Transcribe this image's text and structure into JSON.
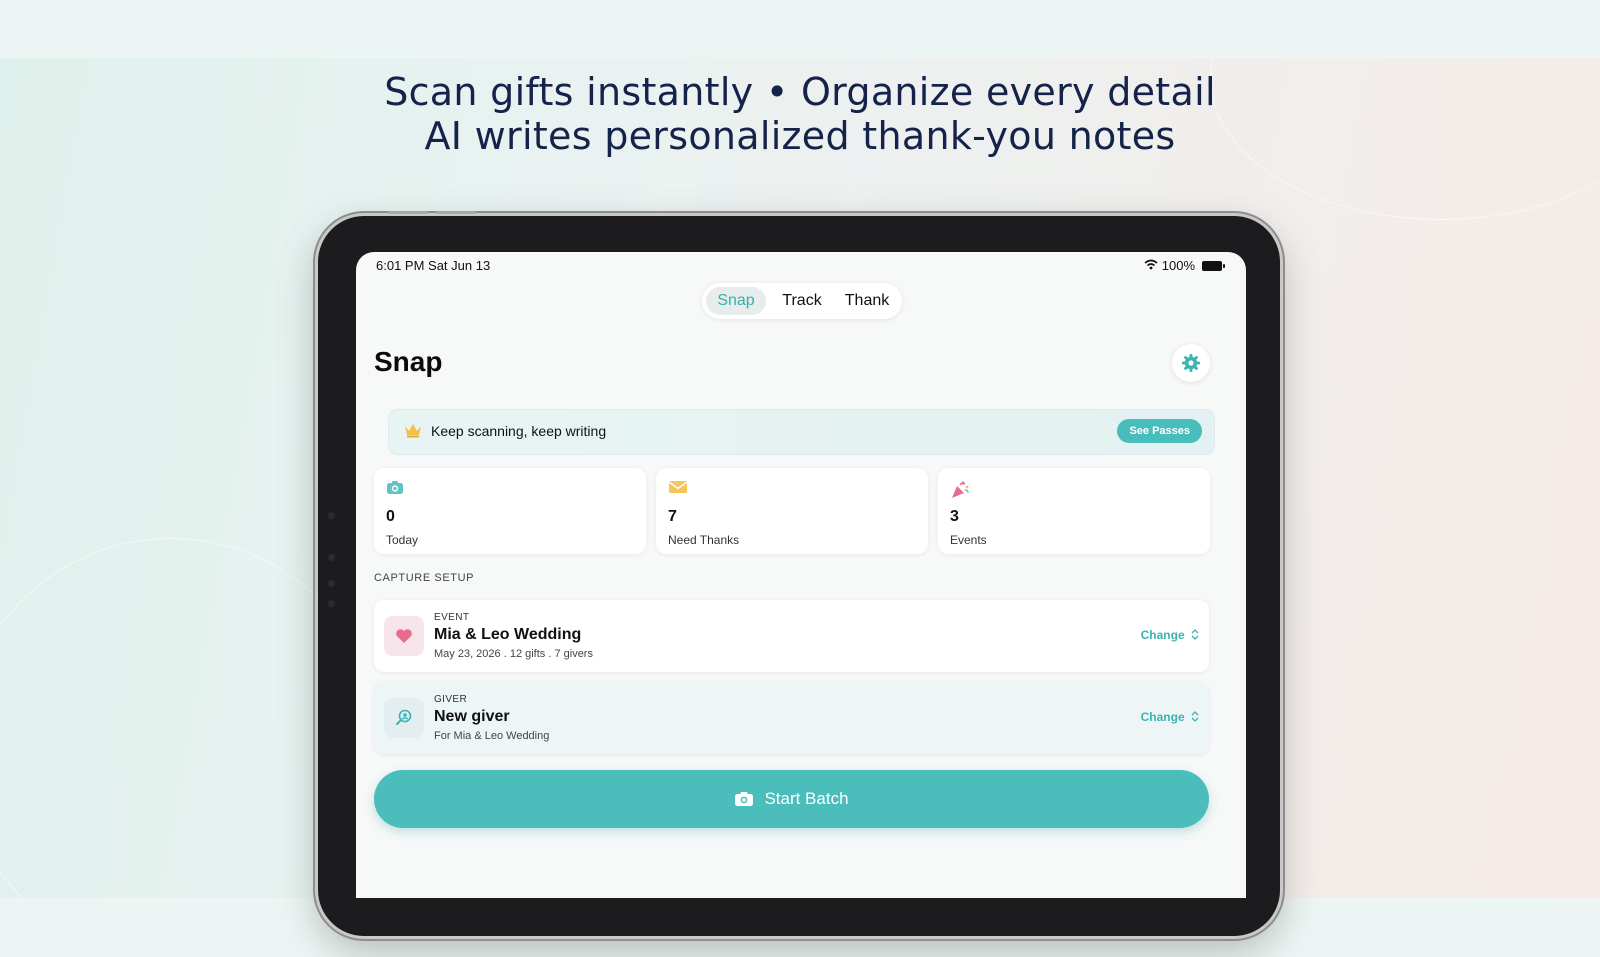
{
  "headline": {
    "line1": "Scan gifts instantly • Organize every detail",
    "line2": "AI writes personalized thank-you notes"
  },
  "status_bar": {
    "time_date": "6:01 PM   Sat Jun 13",
    "battery": "100%"
  },
  "tabs": [
    {
      "label": "Snap",
      "active": true
    },
    {
      "label": "Track",
      "active": false
    },
    {
      "label": "Thank",
      "active": false
    }
  ],
  "page": {
    "title": "Snap",
    "settings_icon": "gear-icon"
  },
  "promo": {
    "icon": "crown-icon",
    "text": "Keep scanning, keep writing",
    "button_label": "See Passes"
  },
  "stats": [
    {
      "icon": "camera-icon",
      "value": "0",
      "label": "Today"
    },
    {
      "icon": "envelope-icon",
      "value": "7",
      "label": "Need Thanks"
    },
    {
      "icon": "party-popper-icon",
      "value": "3",
      "label": "Events"
    }
  ],
  "capture_setup": {
    "heading": "CAPTURE SETUP",
    "event": {
      "kicker": "EVENT",
      "title": "Mia & Leo Wedding",
      "subtitle": "May 23, 2026 . 12 gifts . 7 givers",
      "change_label": "Change",
      "icon": "heart-icon"
    },
    "giver": {
      "kicker": "GIVER",
      "title": "New giver",
      "subtitle": "For Mia & Leo Wedding",
      "change_label": "Change",
      "icon": "person-search-icon"
    }
  },
  "cta": {
    "label": "Start Batch",
    "icon": "camera-icon"
  },
  "colors": {
    "accent": "#4bbdbb",
    "headline": "#15234a",
    "heart": "#e86a8c",
    "crown": "#f2c14b"
  }
}
